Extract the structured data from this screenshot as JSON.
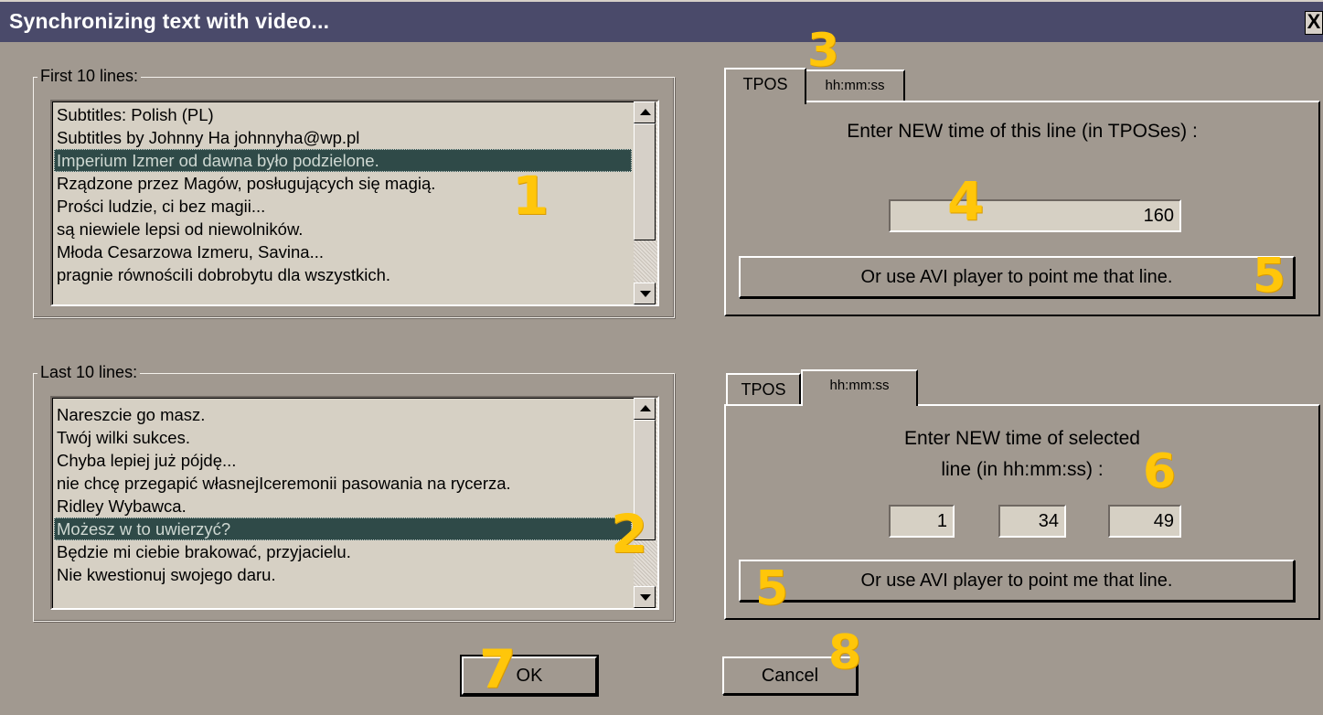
{
  "window": {
    "title": "Synchronizing text with video...",
    "close_label": "X"
  },
  "first_group": {
    "legend": "First 10 lines:",
    "lines": [
      "Subtitles: Polish (PL)",
      "Subtitles by Johnny Ha  johnnyha@wp.pl",
      "Imperium Izmer od dawna było podzielone.",
      "Rządzone przez Magów, posługujących się magią.",
      "Prości ludzie, ci bez magii...",
      "są niewiele lepsi od niewolników.",
      "Młoda Cesarzowa Izmeru, Savina...",
      "pragnie równościIi dobrobytu dla wszystkich."
    ],
    "selected_index": 2
  },
  "last_group": {
    "legend": "Last 10 lines:",
    "lines": [
      "Nareszcie go masz.",
      "Twój wilki sukces.",
      "Chyba lepiej już pójdę...",
      "nie chcę przegapić własnejIceremonii pasowania na rycerza.",
      "Ridley Wybawca.",
      "Możesz w to uwierzyć?",
      "Będzie mi ciebie brakować, przyjacielu.",
      "Nie kwestionuj swojego daru."
    ],
    "selected_index": 5
  },
  "top_panel": {
    "tabs": [
      {
        "label": "TPOS",
        "active": true
      },
      {
        "label": "hh:mm:ss",
        "active": false
      }
    ],
    "prompt": "Enter NEW time of this line (in TPOSes) :",
    "tpos_value": "160",
    "avi_button": "Or use AVI player to point me that line."
  },
  "bottom_panel": {
    "tabs": [
      {
        "label": "TPOS",
        "active": false
      },
      {
        "label": "hh:mm:ss",
        "active": true
      }
    ],
    "prompt_line1": "Enter NEW time of selected",
    "prompt_line2": "line (in hh:mm:ss) :",
    "hours": "1",
    "minutes": "34",
    "seconds": "49",
    "avi_button": "Or use AVI player to point me that line."
  },
  "buttons": {
    "ok": "OK",
    "cancel": "Cancel"
  },
  "annotations": {
    "n1": "1",
    "n2": "2",
    "n3": "3",
    "n4": "4",
    "n5a": "5",
    "n5b": "5",
    "n6": "6",
    "n7": "7",
    "n8": "8",
    "color": "#ffc60a"
  },
  "colors": {
    "dialog_bg": "#a19990",
    "titlebar": "#4a4a6a",
    "selection": "#2f4a48",
    "list_bg": "#d6d0c4"
  }
}
